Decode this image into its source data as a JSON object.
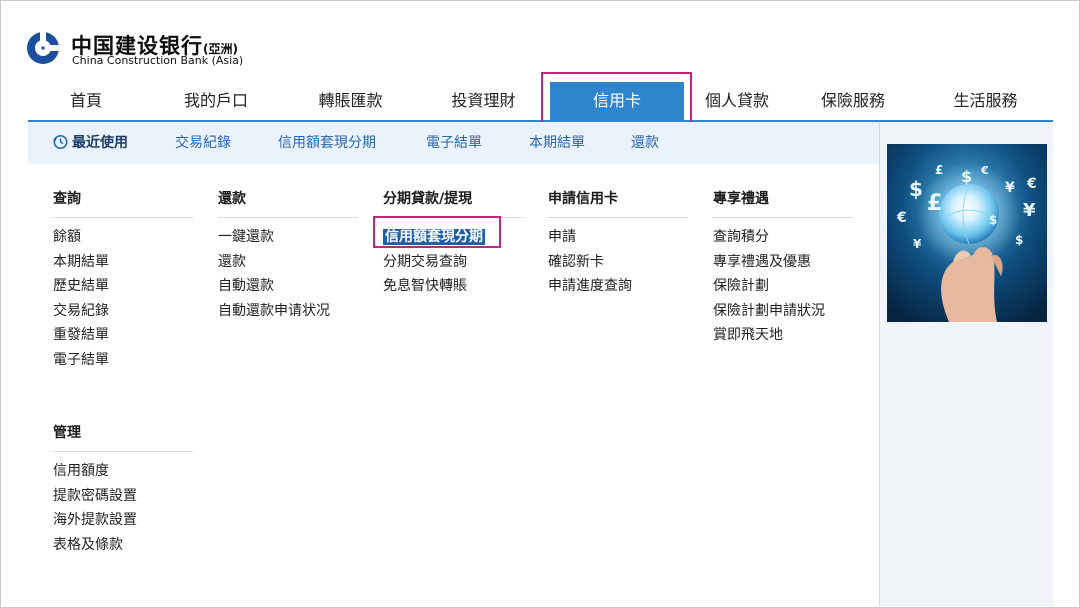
{
  "logo": {
    "name_cn": "中国建设银行",
    "name_cn_suffix": "(亞洲)",
    "name_en": "China Construction Bank (Asia)"
  },
  "main_nav": {
    "items": [
      {
        "label": "首頁"
      },
      {
        "label": "我的戶口"
      },
      {
        "label": "轉賬匯款"
      },
      {
        "label": "投資理財"
      },
      {
        "label": "信用卡",
        "active": true
      },
      {
        "label": "個人貸款"
      },
      {
        "label": "保險服務"
      },
      {
        "label": "生活服務"
      }
    ]
  },
  "sub_nav": {
    "recent": "最近使用",
    "items": [
      {
        "label": "交易紀錄"
      },
      {
        "label": "信用額套現分期"
      },
      {
        "label": "電子結單"
      },
      {
        "label": "本期結單"
      },
      {
        "label": "還款"
      }
    ]
  },
  "menu": {
    "query": {
      "title": "查詢",
      "items": [
        "餘額",
        "本期結單",
        "歷史結單",
        "交易紀錄",
        "重發結單",
        "電子結單"
      ]
    },
    "repay": {
      "title": "還款",
      "items": [
        "一鍵還款",
        "還款",
        "自動還款",
        "自動還款申请状况"
      ]
    },
    "installment": {
      "title": "分期貸款/提現",
      "items": [
        "信用額套現分期",
        "分期交易查詢",
        "免息智快轉賬"
      ],
      "selected_index": 0
    },
    "apply": {
      "title": "申請信用卡",
      "items": [
        "申請",
        "確認新卡",
        "申請進度查詢"
      ]
    },
    "perks": {
      "title": "專享禮遇",
      "items": [
        "查詢積分",
        "專享禮遇及優惠",
        "保險計劃",
        "保險計劃申請狀況",
        "賞即飛天地"
      ]
    },
    "manage": {
      "title": "管理",
      "items": [
        "信用額度",
        "提款密碼設置",
        "海外提款設置",
        "表格及條款"
      ]
    }
  },
  "colors": {
    "accent": "#2f86cd",
    "highlight": "#c2237c",
    "link": "#2a66ad",
    "selected_bg": "#1f5ea8"
  },
  "promo": {
    "symbols": [
      "$",
      "€",
      "¥",
      "£",
      "$",
      "€",
      "¥",
      "$",
      "£",
      "€",
      "¥",
      "$"
    ]
  }
}
